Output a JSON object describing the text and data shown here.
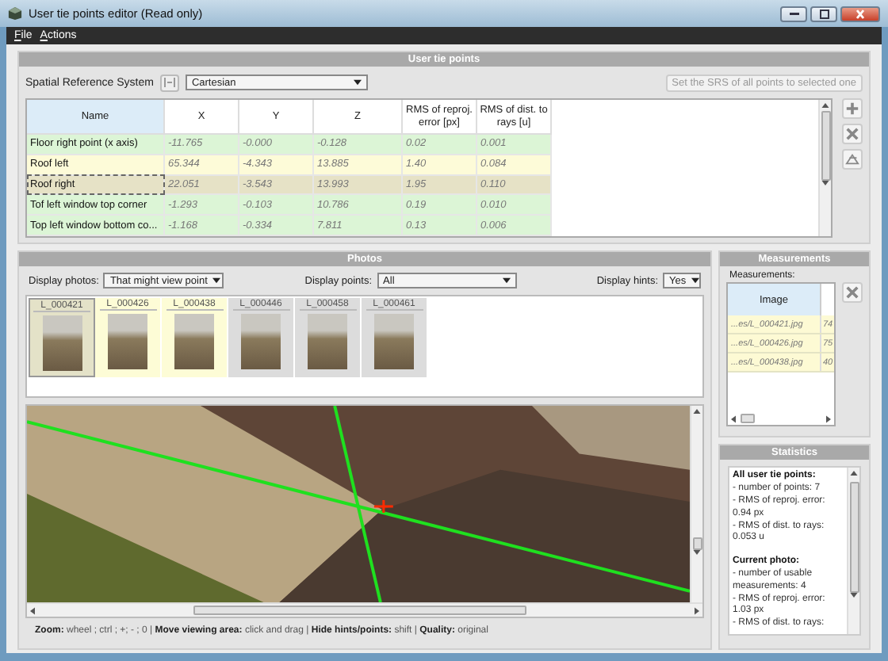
{
  "window": {
    "title": "User tie points editor (Read only)"
  },
  "menu": [
    "File",
    "Actions"
  ],
  "tie_points": {
    "title": "User tie points",
    "srs_label": "Spatial Reference System",
    "srs_value": "Cartesian",
    "set_srs_button": {
      "label": "Set the SRS of all points to selected one",
      "disabled": true
    },
    "columns": [
      "Name",
      "X",
      "Y",
      "Z",
      "RMS of reproj. error [px]",
      "RMS of dist. to rays [u]"
    ],
    "rows": [
      {
        "cells": [
          "Floor right point (x axis)",
          "-11.765",
          "-0.000",
          "-0.128",
          "0.02",
          "0.001"
        ],
        "color": "#dcf5d6",
        "selected": false
      },
      {
        "cells": [
          "Roof left",
          "65.344",
          "-4.343",
          "13.885",
          "1.40",
          "0.084"
        ],
        "color": "#fdfbd8",
        "selected": false
      },
      {
        "cells": [
          "Roof right",
          "22.051",
          "-3.543",
          "13.993",
          "1.95",
          "0.110"
        ],
        "color": "#e6e2c6",
        "selected": true
      },
      {
        "cells": [
          "Tof left window top corner",
          "-1.293",
          "-0.103",
          "10.786",
          "0.19",
          "0.010"
        ],
        "color": "#dcf5d6",
        "selected": false
      },
      {
        "cells": [
          "Top left window bottom co...",
          "-1.168",
          "-0.334",
          "7.811",
          "0.13",
          "0.006"
        ],
        "color": "#dcf5d6",
        "selected": false
      }
    ]
  },
  "photos": {
    "title": "Photos",
    "display_photos_label": "Display photos:",
    "display_photos_value": "That might view point",
    "display_points_label": "Display points:",
    "display_points_value": "All",
    "display_hints_label": "Display hints:",
    "display_hints_value": "Yes",
    "thumbnails": [
      {
        "label": "L_000421",
        "color": "#e4e2c8",
        "selected": true
      },
      {
        "label": "L_000426",
        "color": "#fdfcd6",
        "selected": false
      },
      {
        "label": "L_000438",
        "color": "#fdfcd6",
        "selected": false
      },
      {
        "label": "L_000446",
        "color": "#dcdcdc",
        "selected": false
      },
      {
        "label": "L_000458",
        "color": "#dcdcdc",
        "selected": false
      },
      {
        "label": "L_000461",
        "color": "#dcdcdc",
        "selected": false
      }
    ],
    "hints": "**Zoom:** wheel ; ctrl ; +; - ; 0 | **Move viewing area:** click and drag |  **Hide hints/points:** shift | **Quality:** original"
  },
  "measurements": {
    "title": "Measurements",
    "label": "Measurements:",
    "column": "Image",
    "rows": [
      {
        "image": "...es/L_000421.jpg",
        "column_2": "74"
      },
      {
        "image": "...es/L_000426.jpg",
        "column_2": "75"
      },
      {
        "image": "...es/L_000438.jpg",
        "column_2": "40"
      }
    ]
  },
  "statistics": {
    "title": "Statistics",
    "sections": [
      {
        "heading": "All user tie points:",
        "lines": [
          "- number of points: 7",
          "- RMS of reproj. error: 0.94 px",
          "- RMS of dist. to rays: 0.053 u"
        ]
      },
      {
        "heading": "Current photo:",
        "lines": [
          "- number of usable measurements: 4",
          "- RMS of reproj. error: 1.03 px",
          "- RMS of dist. to rays:"
        ]
      }
    ]
  }
}
